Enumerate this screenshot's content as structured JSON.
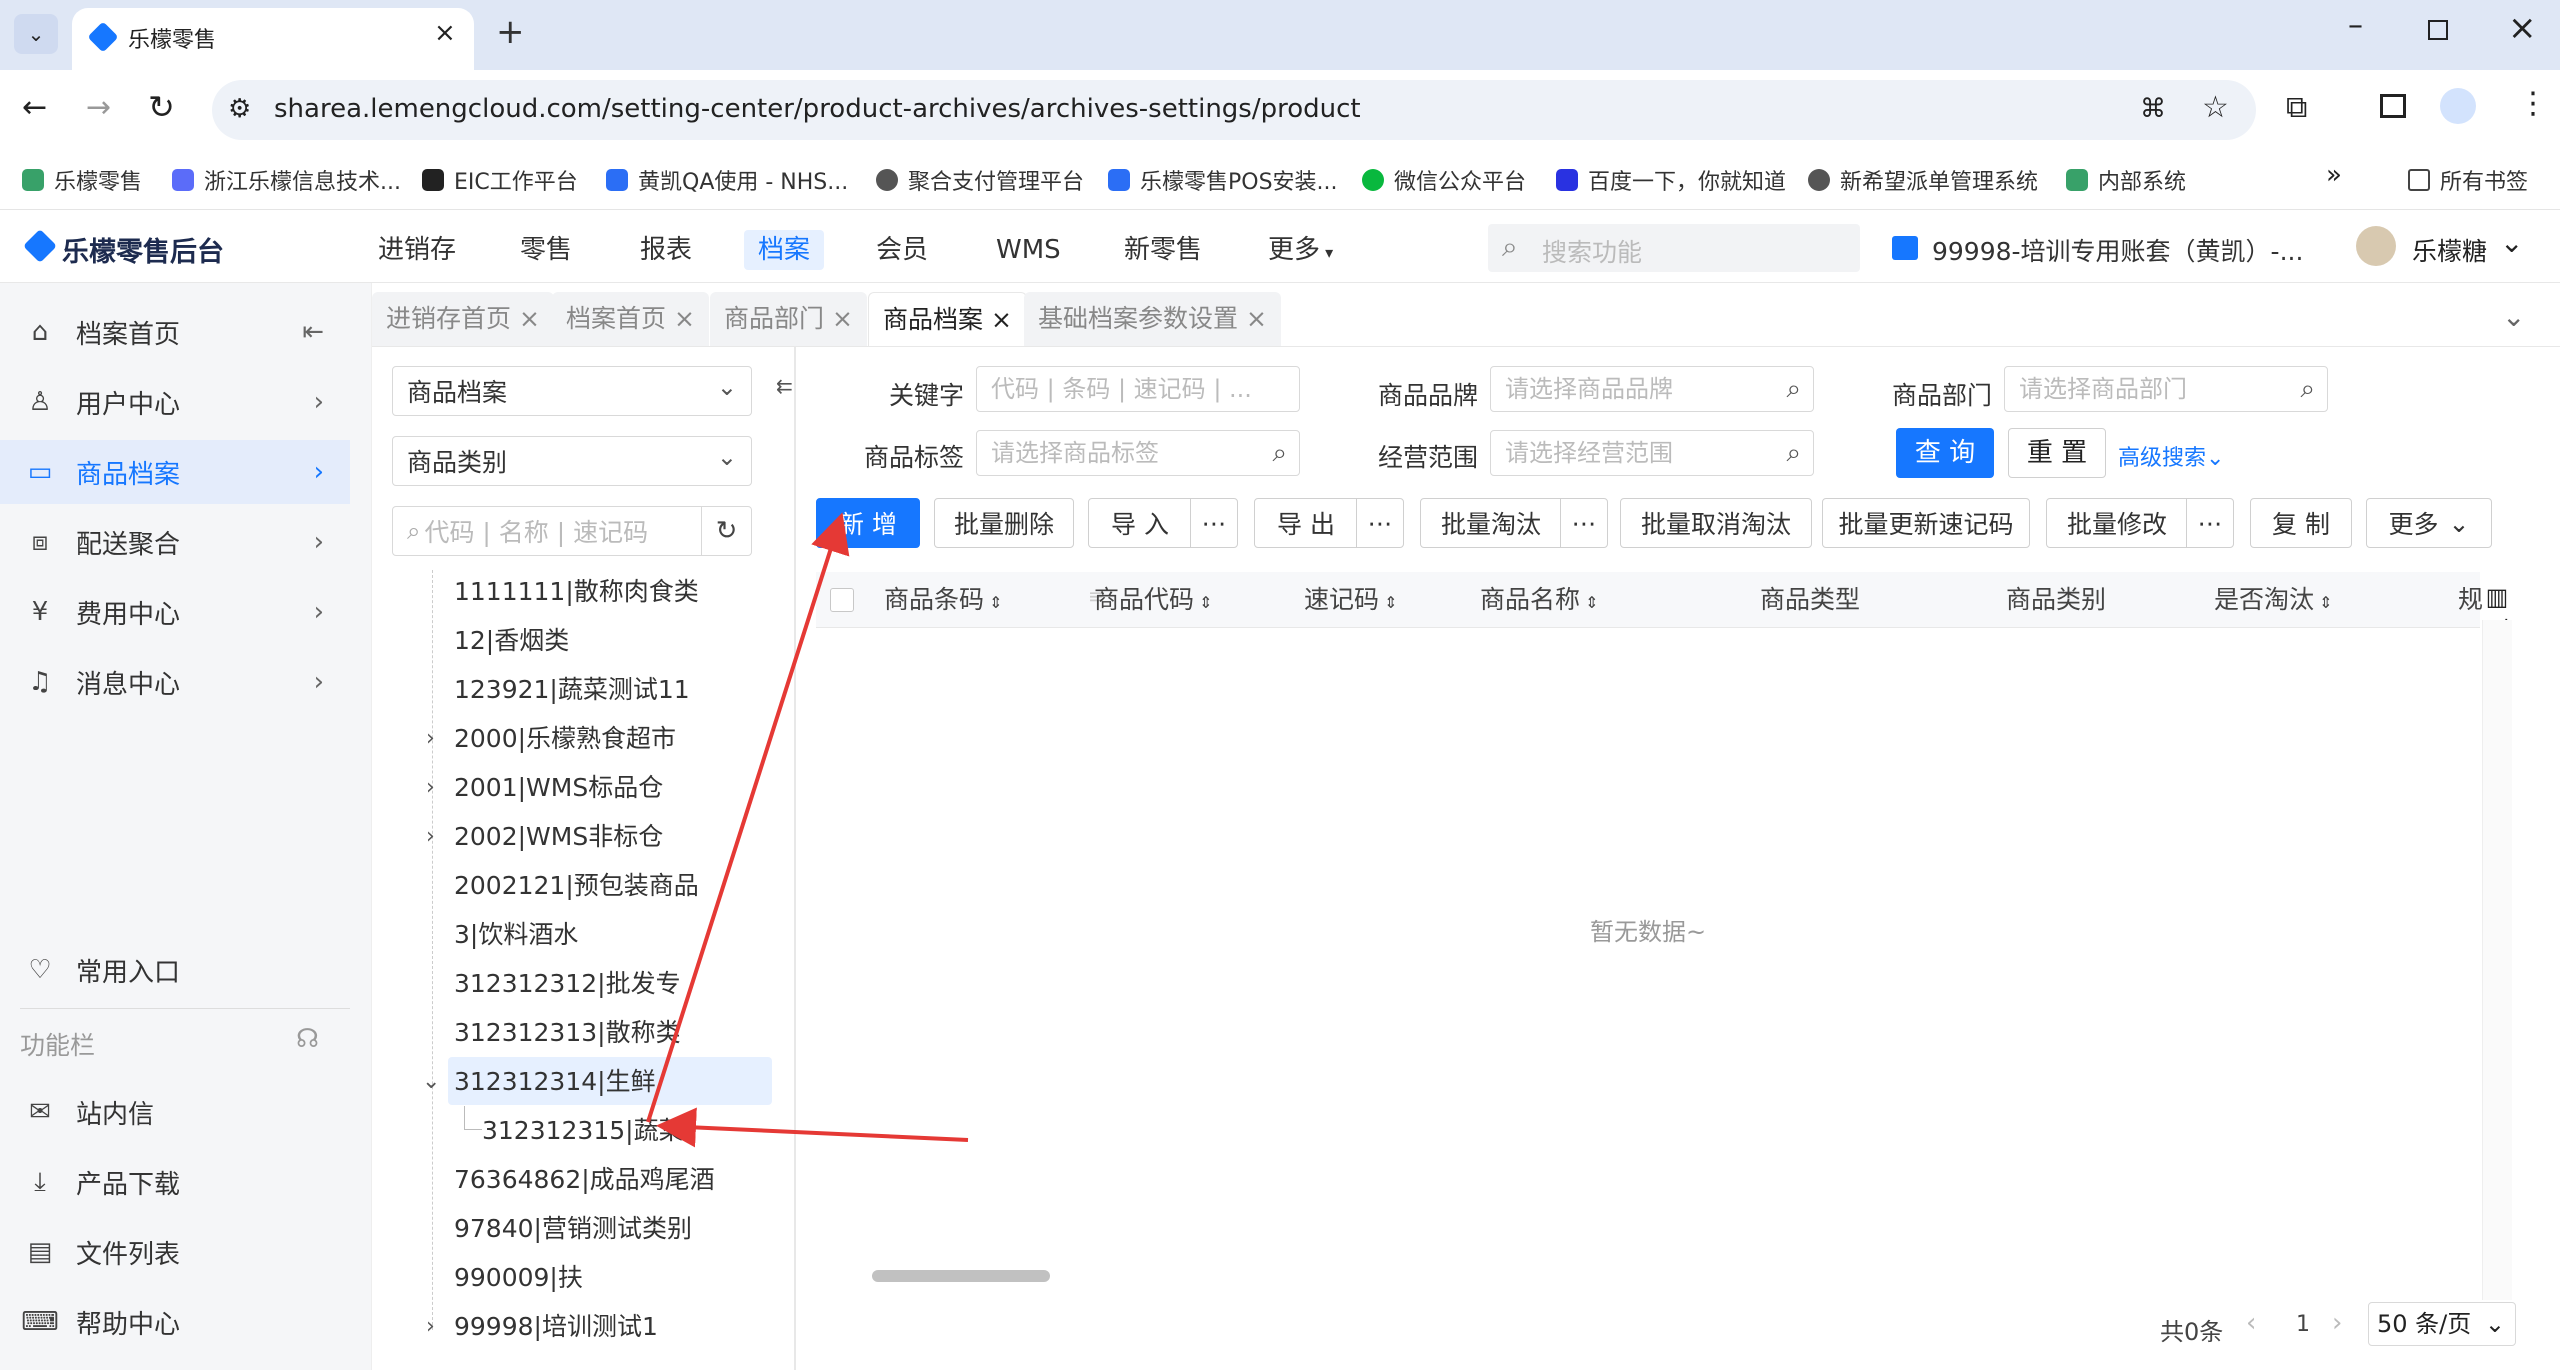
{
  "browser": {
    "tab_title": "乐檬零售",
    "url": "sharea.lemengcloud.com/setting-center/product-archives/archives-settings/product",
    "bookmarks": [
      "乐檬零售",
      "浙江乐檬信息技术...",
      "EIC工作平台",
      "黄凯QA使用 - NHS...",
      "聚合支付管理平台",
      "乐檬零售POS安装...",
      "微信公众平台",
      "百度一下，你就知道",
      "新希望派单管理系统",
      "内部系统"
    ],
    "all_bookmarks": "所有书签"
  },
  "header": {
    "logo": "乐檬零售后台",
    "nav": [
      "进销存",
      "零售",
      "报表",
      "档案",
      "会员",
      "WMS",
      "新零售",
      "更多"
    ],
    "active_nav": "档案",
    "search_placeholder": "搜索功能",
    "account": "99998-培训专用账套（黄凯）-...",
    "user": "乐檬糖"
  },
  "sidebar": {
    "items": [
      {
        "label": "档案首页",
        "icon": "home-icon"
      },
      {
        "label": "用户中心",
        "icon": "user-icon"
      },
      {
        "label": "商品档案",
        "icon": "product-icon"
      },
      {
        "label": "配送聚合",
        "icon": "delivery-icon"
      },
      {
        "label": "费用中心",
        "icon": "yen-icon"
      },
      {
        "label": "消息中心",
        "icon": "bell-icon"
      }
    ],
    "fav": "常用入口",
    "section": "功能栏",
    "bottom": [
      "站内信",
      "产品下载",
      "文件列表",
      "帮助中心"
    ]
  },
  "page_tabs": [
    "进销存首页",
    "档案首页",
    "商品部门",
    "商品档案",
    "基础档案参数设置"
  ],
  "tree": {
    "select1": "商品档案",
    "select2": "商品类别",
    "search_placeholder": "代码 | 名称 | 速记码",
    "nodes": [
      {
        "label": "1111111|散称肉食类",
        "arrow": ""
      },
      {
        "label": "12|香烟类",
        "arrow": ""
      },
      {
        "label": "123921|蔬菜测试11",
        "arrow": ""
      },
      {
        "label": "2000|乐檬熟食超市",
        "arrow": ">"
      },
      {
        "label": "2001|WMS标品仓",
        "arrow": ">"
      },
      {
        "label": "2002|WMS非标仓",
        "arrow": ">"
      },
      {
        "label": "2002121|预包装商品",
        "arrow": ""
      },
      {
        "label": "3|饮料酒水",
        "arrow": ""
      },
      {
        "label": "312312312|批发专",
        "arrow": ""
      },
      {
        "label": "312312313|散称类",
        "arrow": ""
      },
      {
        "label": "312312314|生鲜",
        "arrow": "v"
      },
      {
        "label": "312312315|蔬菜",
        "arrow": ""
      },
      {
        "label": "76364862|成品鸡尾酒",
        "arrow": ""
      },
      {
        "label": "97840|营销测试类别",
        "arrow": ""
      },
      {
        "label": "990009|扶",
        "arrow": ""
      },
      {
        "label": "99998|培训测试1",
        "arrow": ">"
      }
    ]
  },
  "filters": {
    "keyword_label": "关键字",
    "keyword_ph": "代码 | 条码 | 速记码 | ...",
    "brand_label": "商品品牌",
    "brand_ph": "请选择商品品牌",
    "dept_label": "商品部门",
    "dept_ph": "请选择商品部门",
    "tag_label": "商品标签",
    "tag_ph": "请选择商品标签",
    "scope_label": "经营范围",
    "scope_ph": "请选择经营范围",
    "query": "查 询",
    "reset": "重 置",
    "advanced": "高级搜索"
  },
  "toolbar": [
    "新 增",
    "批量删除",
    "导 入",
    "导 出",
    "批量淘汰",
    "批量取消淘汰",
    "批量更新速记码",
    "批量修改",
    "复 制",
    "更多"
  ],
  "table": {
    "columns": [
      "商品条码",
      "商品代码",
      "速记码",
      "商品名称",
      "商品类型",
      "商品类别",
      "是否淘汰",
      "规"
    ],
    "col_setting": "列",
    "empty": "暂无数据~",
    "total": "共0条",
    "page": "1",
    "page_size": "50 条/页"
  },
  "colors": {
    "accent": "#1677ff",
    "arrow": "#e53935"
  }
}
